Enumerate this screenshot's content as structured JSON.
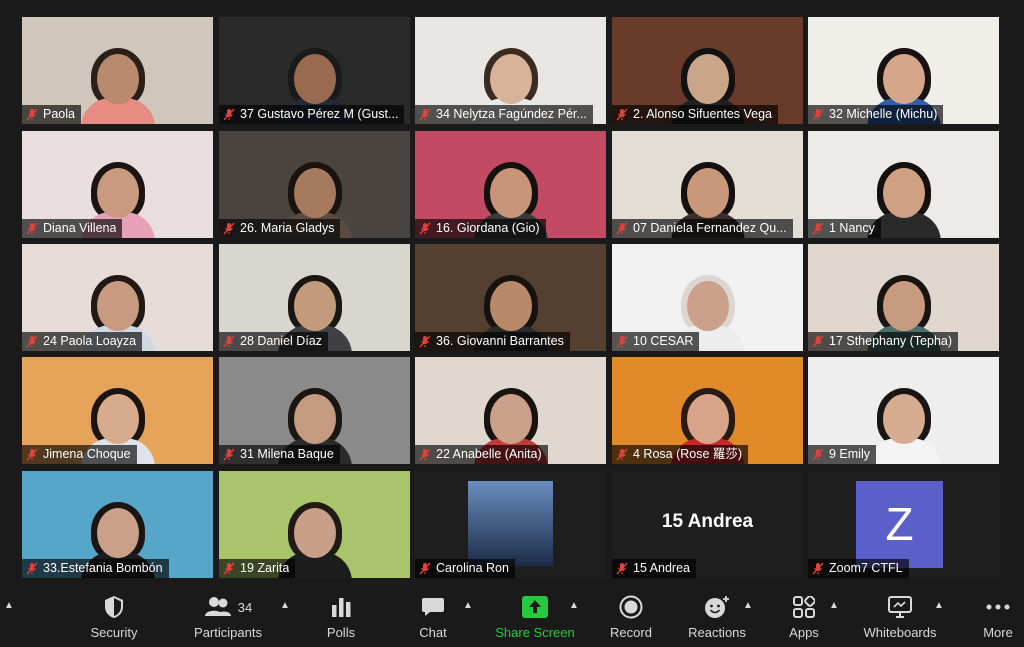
{
  "participants": [
    {
      "name": "Paola",
      "bg": "#cfc7bb",
      "skin": "#b98a6e",
      "hair": "#2b1f1a",
      "shirt": "#e78c82"
    },
    {
      "name": "37 Gustavo Pérez M (Gust...",
      "bg": "#2a2a2a",
      "skin": "#9a6a50",
      "hair": "#1a1a1a",
      "shirt": "#1f2a3a"
    },
    {
      "name": "34 Nelytza Fagúndez Pér...",
      "bg": "#e8e6e2",
      "skin": "#d6b39a",
      "hair": "#3a2a20",
      "shirt": "#e9e9ea"
    },
    {
      "name": "2. Alonso Sifuentes Vega",
      "bg": "#6a3a2a",
      "skin": "#c9a58a",
      "hair": "#121212",
      "shirt": "#202020"
    },
    {
      "name": "32 Michelle (Michu)",
      "bg": "#efeee9",
      "skin": "#d5a68a",
      "hair": "#181212",
      "shirt": "#2f5fa8"
    },
    {
      "name": "Diana Villena",
      "bg": "#e9dfe0",
      "skin": "#c99a80",
      "hair": "#1c1410",
      "shirt": "#e6a1b8"
    },
    {
      "name": "26. Maria Gladys",
      "bg": "#4a4440",
      "skin": "#a77a5f",
      "hair": "#1a1410",
      "shirt": "#5a4a40"
    },
    {
      "name": "16. Giordana (Gio)",
      "bg": "#c24a62",
      "skin": "#c9957a",
      "hair": "#141010",
      "shirt": "#3a3a3a"
    },
    {
      "name": "07 Daniela Fernandez Qu...",
      "bg": "#e3ddd6",
      "skin": "#c9987a",
      "hair": "#151010",
      "shirt": "#3a2f2a"
    },
    {
      "name": "1 Nancy",
      "bg": "#ecebe8",
      "skin": "#cfa082",
      "hair": "#141010",
      "shirt": "#2a2a2a"
    },
    {
      "name": "24 Paola Loayza",
      "bg": "#e6dcd8",
      "skin": "#c99a82",
      "hair": "#221814",
      "shirt": "#cfd7e2"
    },
    {
      "name": "28 Daniel Díaz",
      "bg": "#d9d5cf",
      "skin": "#c29a7c",
      "hair": "#1a1612",
      "shirt": "#3f3f44"
    },
    {
      "name": "36. Giovanni Barrantes",
      "bg": "#544030",
      "skin": "#b98a6a",
      "hair": "#161210",
      "shirt": "#2a2a2a"
    },
    {
      "name": "10 CESAR",
      "bg": "#f2f2f2",
      "skin": "#caa08a",
      "hair": "#ddd6d0",
      "shirt": "#ededed"
    },
    {
      "name": "17 Sthephany (Tepha)",
      "bg": "#e0d8cf",
      "skin": "#c89a80",
      "hair": "#1a1410",
      "shirt": "#4a6e6a"
    },
    {
      "name": "Jimena Choque",
      "bg": "#e6a45a",
      "skin": "#d8ab8c",
      "hair": "#1b1410",
      "shirt": "#dfe3ea"
    },
    {
      "name": "31 Milena Baque",
      "bg": "#8a8a8a",
      "skin": "#c49a80",
      "hair": "#1c1612",
      "shirt": "#2a2a2a"
    },
    {
      "name": "22 Anabelle (Anita)",
      "bg": "#e0d8d0",
      "skin": "#caa08a",
      "hair": "#181210",
      "shirt": "#c23a3a"
    },
    {
      "name": "4 Rosa (Rose 羅莎)",
      "bg": "#e08a2a",
      "skin": "#d8a48a",
      "hair": "#2a1a14",
      "shirt": "#c8262a"
    },
    {
      "name": "9 Emily",
      "bg": "#eeeeee",
      "skin": "#d7ab90",
      "hair": "#1a1414",
      "shirt": "#f3f3f3"
    },
    {
      "name": "33.Estefania Bombón",
      "bg": "#55a6c8",
      "skin": "#caa08a",
      "hair": "#1a1412",
      "shirt": "#1c1c1c"
    },
    {
      "name": "19 Zarita",
      "bg": "#a9c46a",
      "skin": "#c8a08a",
      "hair": "#221a14",
      "shirt": "#1d1d1d"
    },
    {
      "name": "Carolina Ron",
      "bg": "#1e1e1e",
      "skin": "",
      "hair": "",
      "shirt": ""
    },
    {
      "name": "15 Andrea",
      "bg": "#1e1e1e",
      "big": "15 Andrea"
    },
    {
      "name": "Zoom7 CTFL",
      "bg": "#1e1e1e",
      "avatar": "Z"
    }
  ],
  "toolbar": {
    "security": "Security",
    "participants": "Participants",
    "participants_count": "34",
    "polls": "Polls",
    "chat": "Chat",
    "share": "Share Screen",
    "record": "Record",
    "reactions": "Reactions",
    "apps": "Apps",
    "whiteboards": "Whiteboards",
    "more": "More"
  }
}
